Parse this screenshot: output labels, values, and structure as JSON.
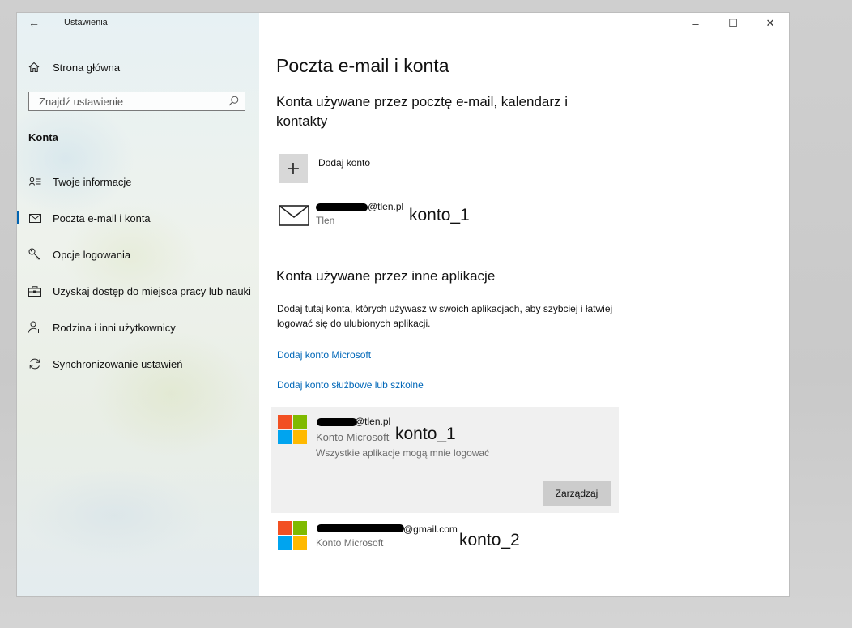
{
  "app": {
    "back_glyph": "←",
    "title": "Ustawienia"
  },
  "sidebar": {
    "home_label": "Strona główna",
    "search_placeholder": "Znajdź ustawienie",
    "section": "Konta",
    "items": [
      {
        "label": "Twoje informacje",
        "icon": "contact-info-icon",
        "active": false
      },
      {
        "label": "Poczta e-mail i konta",
        "icon": "mail-icon",
        "active": true
      },
      {
        "label": "Opcje logowania",
        "icon": "key-icon",
        "active": false
      },
      {
        "label": "Uzyskaj dostęp do miejsca pracy lub nauki",
        "icon": "briefcase-icon",
        "active": false
      },
      {
        "label": "Rodzina i inni użytkownicy",
        "icon": "person-add-icon",
        "active": false
      },
      {
        "label": "Synchronizowanie ustawień",
        "icon": "sync-icon",
        "active": false
      }
    ]
  },
  "window_controls": {
    "minimize": "–",
    "maximize": "☐",
    "close": "✕"
  },
  "main": {
    "title": "Poczta e-mail i konta",
    "email_section_title": "Konta używane przez pocztę e-mail, kalendarz i kontakty",
    "add_account_label": "Dodaj konto",
    "email_account": {
      "email": "@tlen.pl",
      "provider": "Tlen",
      "annotation": "konto_1"
    },
    "other_apps_title": "Konta używane przez inne aplikacje",
    "other_apps_description": "Dodaj tutaj konta, których używasz w swoich aplikacjach, aby szybciej i łatwiej logować się do ulubionych aplikacji.",
    "add_microsoft_link": "Dodaj konto Microsoft",
    "add_work_link": "Dodaj konto służbowe lub szkolne",
    "ms_accounts": [
      {
        "email": "@tlen.pl",
        "type": "Konto Microsoft",
        "detail": "Wszystkie aplikacje mogą mnie logować",
        "annotation": "konto_1",
        "button": "Zarządzaj"
      },
      {
        "email": "@gmail.com",
        "type": "Konto Microsoft",
        "annotation": "konto_2"
      }
    ]
  },
  "colors": {
    "accent": "#0063b1",
    "link": "#0067b8",
    "ms_red": "#f25022",
    "ms_green": "#7fba00",
    "ms_blue": "#00a4ef",
    "ms_yellow": "#ffb900"
  }
}
